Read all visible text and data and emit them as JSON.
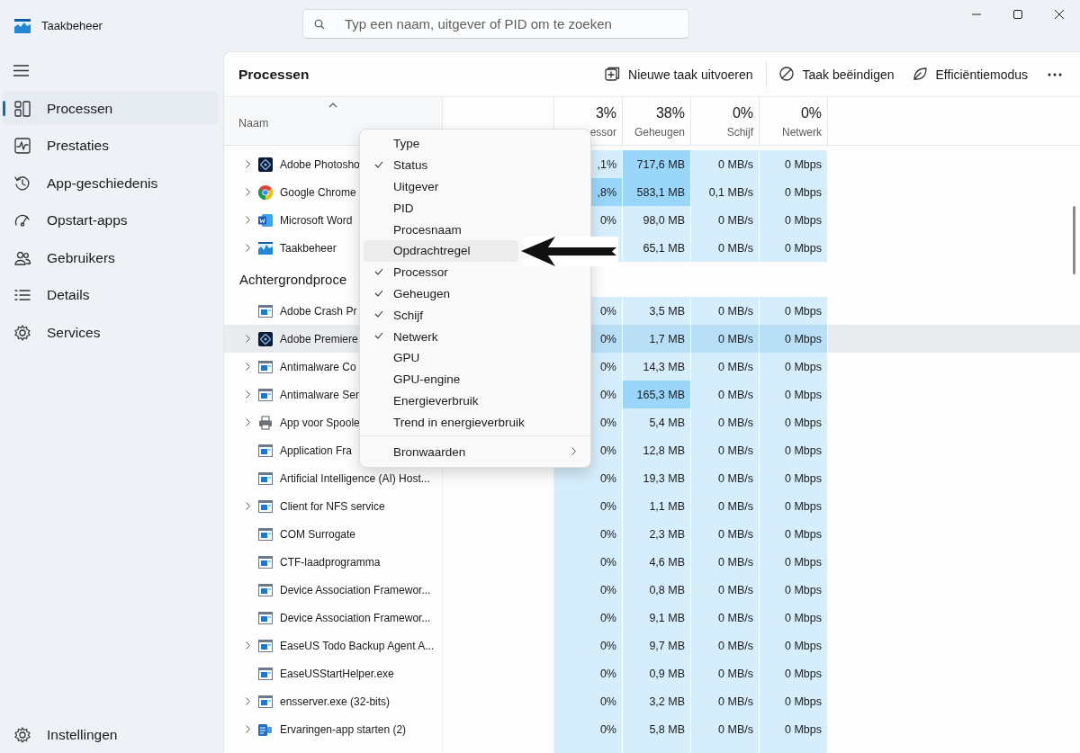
{
  "window": {
    "title": "Taakbeheer"
  },
  "search": {
    "placeholder": "Typ een naam, uitgever of PID om te zoeken"
  },
  "sidebar": {
    "items": [
      {
        "label": "Processen",
        "selected": true
      },
      {
        "label": "Prestaties",
        "selected": false
      },
      {
        "label": "App-geschiedenis",
        "selected": false
      },
      {
        "label": "Opstart-apps",
        "selected": false
      },
      {
        "label": "Gebruikers",
        "selected": false
      },
      {
        "label": "Details",
        "selected": false
      },
      {
        "label": "Services",
        "selected": false
      }
    ],
    "footer": {
      "label": "Instellingen"
    }
  },
  "toolbar": {
    "title": "Processen",
    "actions": [
      "Nieuwe taak uitvoeren",
      "Taak beëindigen",
      "Efficiëntiemodus"
    ]
  },
  "table": {
    "columns": [
      {
        "label": "Naam"
      },
      {
        "percent": "3%",
        "label": "essor"
      },
      {
        "percent": "38%",
        "label": "Geheugen"
      },
      {
        "percent": "0%",
        "label": "Schijf"
      },
      {
        "percent": "0%",
        "label": "Netwerk"
      }
    ],
    "rows": [
      {
        "kind": "process",
        "name": "Adobe Photosho",
        "expandable": true,
        "selected": false,
        "cells": [
          ",1%",
          "717,6 MB",
          "0 MB/s",
          "0 Mbps"
        ],
        "heavy": [
          false,
          true,
          false,
          false
        ]
      },
      {
        "kind": "process",
        "name": "Google Chrome",
        "expandable": true,
        "selected": false,
        "cells": [
          ",8%",
          "583,1 MB",
          "0,1 MB/s",
          "0 Mbps"
        ],
        "heavy": [
          true,
          true,
          false,
          false
        ]
      },
      {
        "kind": "process",
        "name": "Microsoft Word",
        "expandable": true,
        "selected": false,
        "cells": [
          "0%",
          "98,0 MB",
          "0 MB/s",
          "0 Mbps"
        ],
        "heavy": [
          false,
          false,
          false,
          false
        ]
      },
      {
        "kind": "process",
        "name": "Taakbeheer",
        "expandable": true,
        "selected": false,
        "cells": [
          null,
          "65,1 MB",
          "0 MB/s",
          "0 Mbps"
        ],
        "heavy": [
          false,
          false,
          false,
          false
        ]
      },
      {
        "kind": "group",
        "name": "Achtergrondproce"
      },
      {
        "kind": "process",
        "name": "Adobe Crash Pr",
        "expandable": false,
        "selected": false,
        "cells": [
          "0%",
          "3,5 MB",
          "0 MB/s",
          "0 Mbps"
        ],
        "heavy": [
          false,
          false,
          false,
          false
        ]
      },
      {
        "kind": "process",
        "name": "Adobe Premiere",
        "expandable": true,
        "selected": true,
        "cells": [
          "0%",
          "1,7 MB",
          "0 MB/s",
          "0 Mbps"
        ],
        "heavy": [
          false,
          false,
          false,
          false
        ]
      },
      {
        "kind": "process",
        "name": "Antimalware Co",
        "expandable": true,
        "selected": false,
        "cells": [
          "0%",
          "14,3 MB",
          "0 MB/s",
          "0 Mbps"
        ],
        "heavy": [
          false,
          false,
          false,
          false
        ]
      },
      {
        "kind": "process",
        "name": "Antimalware Ser",
        "expandable": true,
        "selected": false,
        "cells": [
          "0%",
          "165,3 MB",
          "0 MB/s",
          "0 Mbps"
        ],
        "heavy": [
          false,
          true,
          false,
          false
        ]
      },
      {
        "kind": "process",
        "name": "App voor Spoole",
        "expandable": true,
        "selected": false,
        "cells": [
          "0%",
          "5,4 MB",
          "0 MB/s",
          "0 Mbps"
        ],
        "heavy": [
          false,
          false,
          false,
          false
        ]
      },
      {
        "kind": "process",
        "name": "Application Fra",
        "expandable": false,
        "selected": false,
        "cells": [
          "0%",
          "12,8 MB",
          "0 MB/s",
          "0 Mbps"
        ],
        "heavy": [
          false,
          false,
          false,
          false
        ]
      },
      {
        "kind": "process",
        "name": "Artificial Intelligence (AI) Host...",
        "expandable": false,
        "selected": false,
        "cells": [
          "0%",
          "19,3 MB",
          "0 MB/s",
          "0 Mbps"
        ],
        "heavy": [
          false,
          false,
          false,
          false
        ]
      },
      {
        "kind": "process",
        "name": "Client for NFS service",
        "expandable": true,
        "selected": false,
        "cells": [
          "0%",
          "1,1 MB",
          "0 MB/s",
          "0 Mbps"
        ],
        "heavy": [
          false,
          false,
          false,
          false
        ]
      },
      {
        "kind": "process",
        "name": "COM Surrogate",
        "expandable": false,
        "selected": false,
        "cells": [
          "0%",
          "2,3 MB",
          "0 MB/s",
          "0 Mbps"
        ],
        "heavy": [
          false,
          false,
          false,
          false
        ]
      },
      {
        "kind": "process",
        "name": "CTF-laadprogramma",
        "expandable": false,
        "selected": false,
        "cells": [
          "0%",
          "4,6 MB",
          "0 MB/s",
          "0 Mbps"
        ],
        "heavy": [
          false,
          false,
          false,
          false
        ]
      },
      {
        "kind": "process",
        "name": "Device Association Framewor...",
        "expandable": false,
        "selected": false,
        "cells": [
          "0%",
          "0,8 MB",
          "0 MB/s",
          "0 Mbps"
        ],
        "heavy": [
          false,
          false,
          false,
          false
        ]
      },
      {
        "kind": "process",
        "name": "Device Association Framewor...",
        "expandable": false,
        "selected": false,
        "cells": [
          "0%",
          "9,1 MB",
          "0 MB/s",
          "0 Mbps"
        ],
        "heavy": [
          false,
          false,
          false,
          false
        ]
      },
      {
        "kind": "process",
        "name": "EaseUS Todo Backup Agent A...",
        "expandable": true,
        "selected": false,
        "cells": [
          "0%",
          "9,7 MB",
          "0 MB/s",
          "0 Mbps"
        ],
        "heavy": [
          false,
          false,
          false,
          false
        ]
      },
      {
        "kind": "process",
        "name": "EaseUSStartHelper.exe",
        "expandable": false,
        "selected": false,
        "cells": [
          "0%",
          "0,9 MB",
          "0 MB/s",
          "0 Mbps"
        ],
        "heavy": [
          false,
          false,
          false,
          false
        ]
      },
      {
        "kind": "process",
        "name": "ensserver.exe (32-bits)",
        "expandable": true,
        "selected": false,
        "cells": [
          "0%",
          "3,2 MB",
          "0 MB/s",
          "0 Mbps"
        ],
        "heavy": [
          false,
          false,
          false,
          false
        ]
      },
      {
        "kind": "process",
        "name": "Ervaringen-app starten (2)",
        "expandable": true,
        "selected": false,
        "cells": [
          "0%",
          "5,8 MB",
          "0 MB/s",
          "0 Mbps"
        ],
        "heavy": [
          false,
          false,
          false,
          false
        ]
      }
    ]
  },
  "context_menu": {
    "items": [
      {
        "kind": "item",
        "label": "Type",
        "checked": false,
        "selected": false
      },
      {
        "kind": "item",
        "label": "Status",
        "checked": true,
        "selected": false
      },
      {
        "kind": "item",
        "label": "Uitgever",
        "checked": false,
        "selected": false
      },
      {
        "kind": "item",
        "label": "PID",
        "checked": false,
        "selected": false
      },
      {
        "kind": "item",
        "label": "Procesnaam",
        "checked": false,
        "selected": false
      },
      {
        "kind": "item",
        "label": "Opdrachtregel",
        "checked": false,
        "selected": true
      },
      {
        "kind": "item",
        "label": "Processor",
        "checked": true,
        "selected": false
      },
      {
        "kind": "item",
        "label": "Geheugen",
        "checked": true,
        "selected": false
      },
      {
        "kind": "item",
        "label": "Schijf",
        "checked": true,
        "selected": false
      },
      {
        "kind": "item",
        "label": "Netwerk",
        "checked": true,
        "selected": false
      },
      {
        "kind": "item",
        "label": "GPU",
        "checked": false,
        "selected": false
      },
      {
        "kind": "item",
        "label": "GPU-engine",
        "checked": false,
        "selected": false
      },
      {
        "kind": "item",
        "label": "Energieverbruik",
        "checked": false,
        "selected": false
      },
      {
        "kind": "item",
        "label": "Trend in energieverbruik",
        "checked": false,
        "selected": false
      },
      {
        "kind": "separator"
      },
      {
        "kind": "submenu",
        "label": "Bronwaarden",
        "checked": false,
        "selected": false
      }
    ]
  }
}
